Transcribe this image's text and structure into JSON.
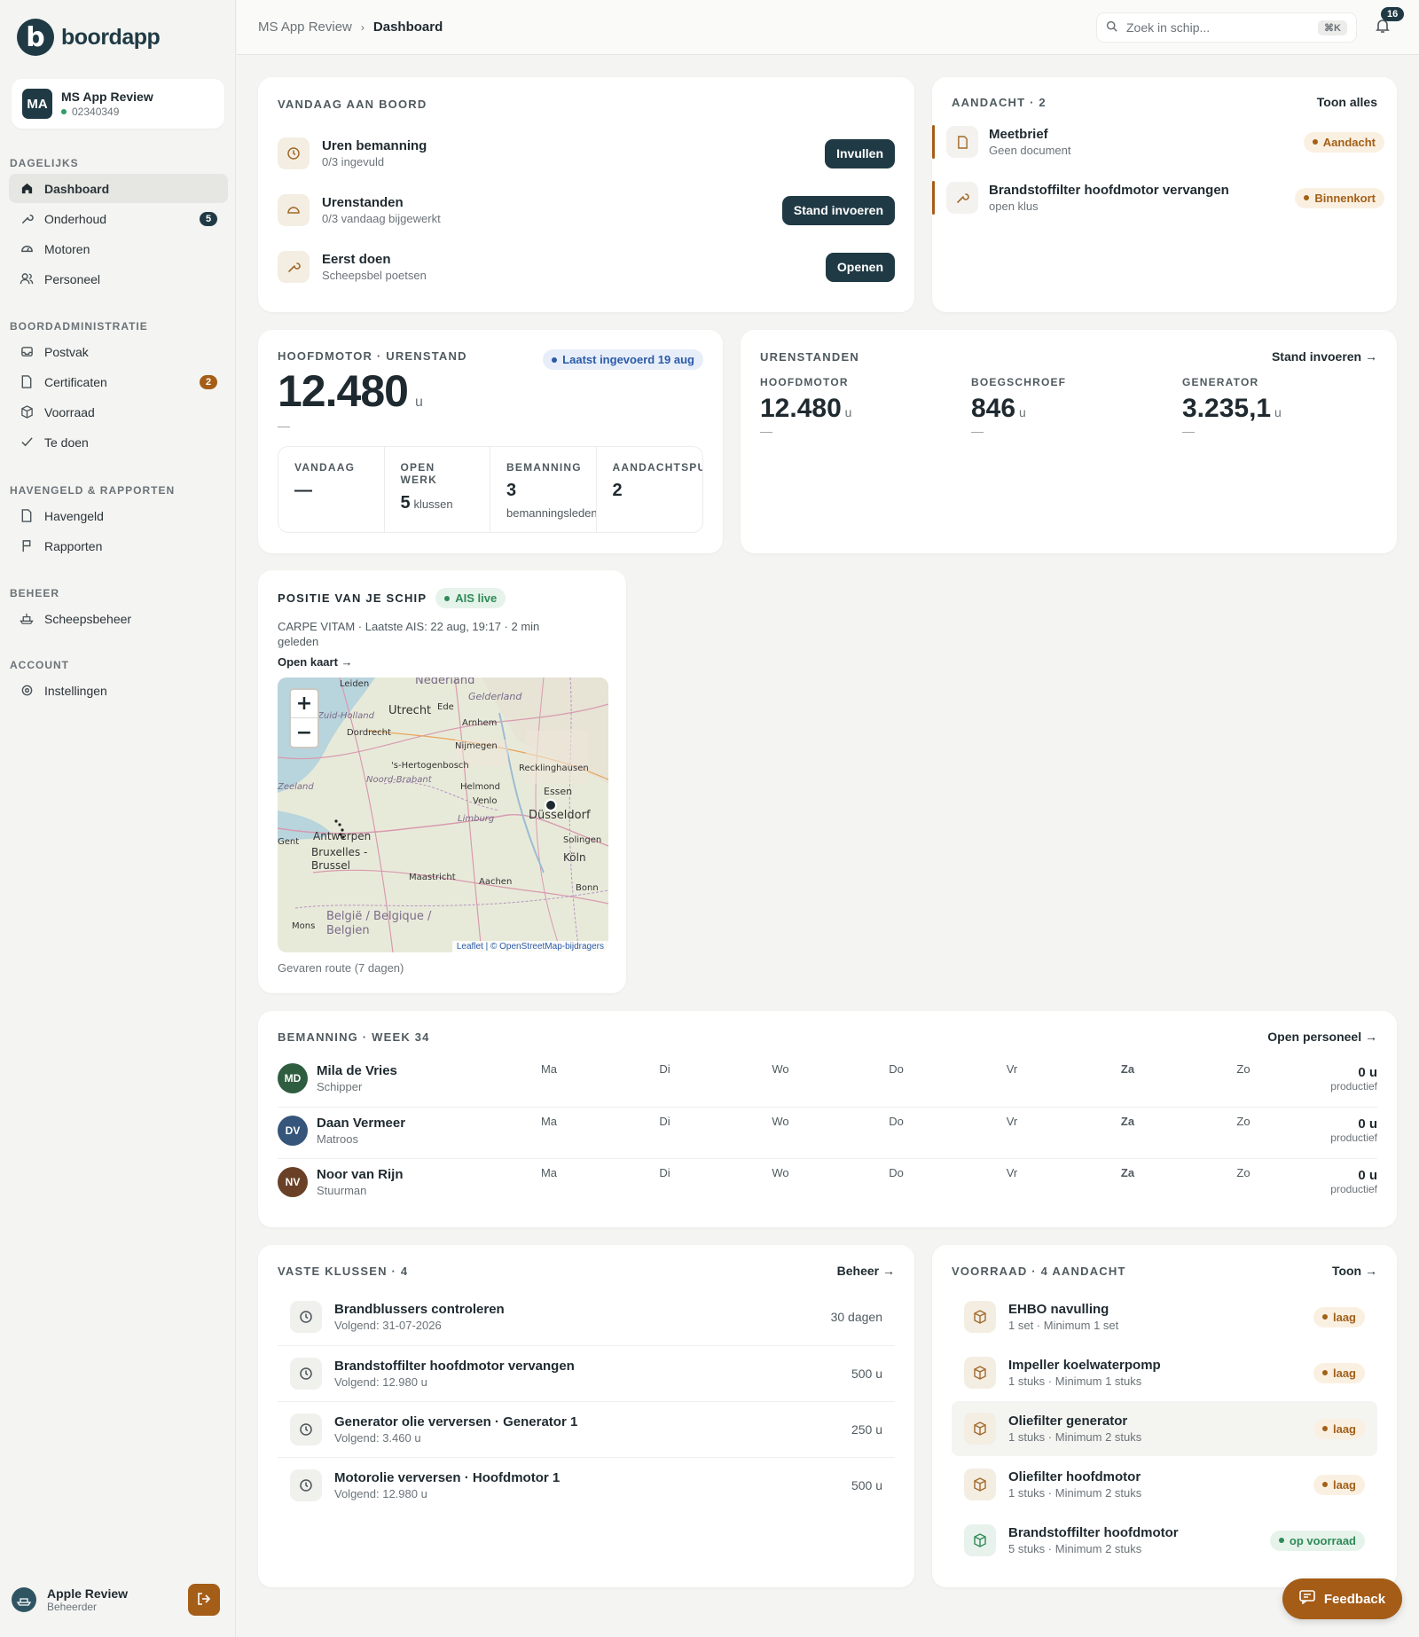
{
  "brand": {
    "name": "boordapp",
    "mark": "b"
  },
  "vessel": {
    "initials": "MA",
    "name": "MS App Review",
    "id": "02340349"
  },
  "nav": {
    "sections": [
      {
        "label": "DAGELIJKS"
      },
      {
        "label": "BOORDADMINISTRATIE"
      },
      {
        "label": "HAVENGELD & RAPPORTEN"
      },
      {
        "label": "BEHEER"
      },
      {
        "label": "ACCOUNT"
      }
    ],
    "items": [
      {
        "label": "Dashboard"
      },
      {
        "label": "Onderhoud",
        "badge": "5"
      },
      {
        "label": "Motoren"
      },
      {
        "label": "Personeel"
      },
      {
        "label": "Postvak"
      },
      {
        "label": "Certificaten",
        "badge": "2"
      },
      {
        "label": "Voorraad"
      },
      {
        "label": "Te doen"
      },
      {
        "label": "Havengeld"
      },
      {
        "label": "Rapporten"
      },
      {
        "label": "Scheepsbeheer"
      },
      {
        "label": "Instellingen"
      }
    ]
  },
  "user": {
    "name": "Apple Review",
    "role": "Beheerder"
  },
  "topbar": {
    "breadcrumb": [
      "MS App Review",
      "Dashboard"
    ],
    "search_placeholder": "Zoek in schip...",
    "search_kbd": "⌘K",
    "notifications": "16"
  },
  "today": {
    "label": "VANDAAG AAN BOORD",
    "rows": [
      {
        "title": "Uren bemanning",
        "sub": "0/3 ingevuld",
        "action": "Invullen"
      },
      {
        "title": "Urenstanden",
        "sub": "0/3 vandaag bijgewerkt",
        "action": "Stand invoeren"
      },
      {
        "title": "Eerst doen",
        "sub": "Scheepsbel poetsen",
        "action": "Openen"
      }
    ]
  },
  "attention": {
    "label": "AANDACHT · 2",
    "link": "Toon alles",
    "rows": [
      {
        "title": "Meetbrief",
        "sub": "Geen document",
        "tag": "Aandacht"
      },
      {
        "title": "Brandstoffilter hoofdmotor vervangen",
        "sub": "open klus",
        "tag": "Binnenkort"
      }
    ]
  },
  "engine": {
    "label": "HOOFDMOTOR · URENSTAND",
    "badge": "Laatst ingevoerd 19 aug",
    "value": "12.480",
    "unit": "u",
    "dash": "—",
    "stats": [
      {
        "label": "VANDAAG",
        "value": "—",
        "unit": "",
        "sub": ""
      },
      {
        "label": "OPEN WERK",
        "value": "5",
        "unit": "klussen",
        "sub": ""
      },
      {
        "label": "BEMANNING",
        "value": "3",
        "unit": "",
        "sub": "bemanningsleden"
      },
      {
        "label": "AANDACHTSPUNTEN",
        "value": "2",
        "unit": "",
        "sub": ""
      }
    ]
  },
  "counters": {
    "label": "URENSTANDEN",
    "link": "Stand invoeren →",
    "items": [
      {
        "label": "HOOFDMOTOR",
        "value": "12.480",
        "unit": "u",
        "dash": "—"
      },
      {
        "label": "BOEGSCHROEF",
        "value": "846",
        "unit": "u",
        "dash": "—"
      },
      {
        "label": "GENERATOR",
        "value": "3.235,1",
        "unit": "u",
        "dash": "—"
      }
    ]
  },
  "position": {
    "label": "POSITIE VAN JE SCHIP",
    "badge": "AIS live",
    "info": "CARPE VITAM · Laatste AIS: 22 aug, 19:17 · 2 min geleden",
    "link": "Open kaart →",
    "zoom_in": "+",
    "zoom_out": "−",
    "attribution": "Leaflet | © OpenStreetMap-bijdragers",
    "caption": "Gevaren route (7 dagen)",
    "places": [
      "Leiden",
      "Nederland",
      "Gelderland",
      "Utrecht",
      "Ede",
      "Zuid-Holland",
      "Dordrecht",
      "Arnhem",
      "Nijmegen",
      "'s-Hertogenbosch",
      "Noord-Brabant",
      "Recklinghausen",
      "Zeeland",
      "Helmond",
      "Venlo",
      "Essen",
      "Düsseldorf",
      "Limburg",
      "Antwerpen",
      "Gent",
      "Bruxelles - Brussel",
      "Solingen",
      "Köln",
      "Maastricht",
      "Aachen",
      "Bonn",
      "België / Belgique / Belgien",
      "Mons"
    ]
  },
  "crew": {
    "label": "BEMANNING · WEEK 34",
    "link": "Open personeel →",
    "days": [
      "Ma",
      "Di",
      "Wo",
      "Do",
      "Vr",
      "Za",
      "Zo"
    ],
    "members": [
      {
        "initials": "MD",
        "name": "Mila de Vries",
        "role": "Schipper",
        "hours": "0 u",
        "hours_label": "productief",
        "color": "#2f5d3f"
      },
      {
        "initials": "DV",
        "name": "Daan Vermeer",
        "role": "Matroos",
        "hours": "0 u",
        "hours_label": "productief",
        "color": "#35557a"
      },
      {
        "initials": "NV",
        "name": "Noor van Rijn",
        "role": "Stuurman",
        "hours": "0 u",
        "hours_label": "productief",
        "color": "#6a4127"
      }
    ]
  },
  "tasks": {
    "label": "VASTE KLUSSEN · 4",
    "link": "Beheer →",
    "rows": [
      {
        "title": "Brandblussers controleren",
        "sub": "Volgend: 31-07-2026",
        "interval": "30 dagen"
      },
      {
        "title": "Brandstoffilter hoofdmotor vervangen",
        "sub": "Volgend: 12.980 u",
        "interval": "500 u"
      },
      {
        "title": "Generator olie verversen · Generator 1",
        "sub": "Volgend: 3.460 u",
        "interval": "250 u"
      },
      {
        "title": "Motorolie verversen · Hoofdmotor 1",
        "sub": "Volgend: 12.980 u",
        "interval": "500 u"
      }
    ]
  },
  "stock": {
    "label": "VOORRAAD · 4 AANDACHT",
    "link": "Toon →",
    "rows": [
      {
        "title": "EHBO navulling",
        "sub": "1 set · Minimum 1 set",
        "tag": "laag",
        "kind": "amber"
      },
      {
        "title": "Impeller koelwaterpomp",
        "sub": "1 stuks · Minimum 1 stuks",
        "tag": "laag",
        "kind": "amber"
      },
      {
        "title": "Oliefilter generator",
        "sub": "1 stuks · Minimum 2 stuks",
        "tag": "laag",
        "kind": "amber"
      },
      {
        "title": "Oliefilter hoofdmotor",
        "sub": "1 stuks · Minimum 2 stuks",
        "tag": "laag",
        "kind": "amber"
      },
      {
        "title": "Brandstoffilter hoofdmotor",
        "sub": "5 stuks · Minimum 2 stuks",
        "tag": "op voorraad",
        "kind": "green"
      }
    ]
  },
  "feedback": {
    "label": "Feedback"
  },
  "colors": {
    "primary": "#1f3a44",
    "accent": "#a55e18",
    "green": "#2f9d67"
  }
}
